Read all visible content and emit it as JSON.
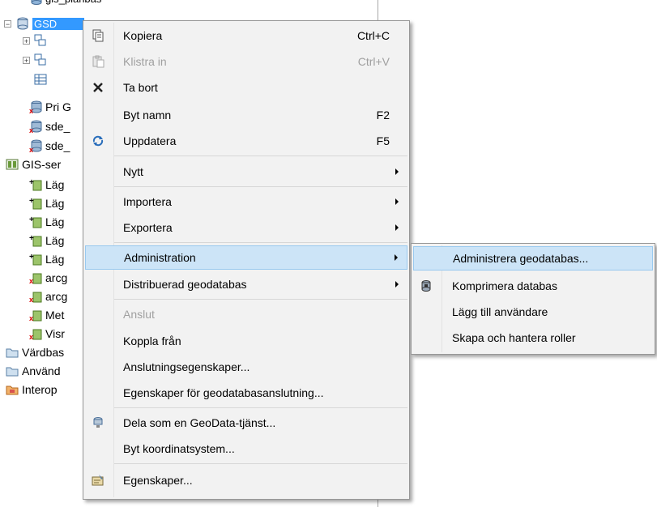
{
  "tree": {
    "partial_top": "gis_planbas",
    "selected": "GSD",
    "items": [
      {
        "label": "Pri G"
      },
      {
        "label": "sde_"
      },
      {
        "label": "sde_"
      },
      {
        "label": "GIS-ser"
      },
      {
        "label": "Läg"
      },
      {
        "label": "Läg"
      },
      {
        "label": "Läg"
      },
      {
        "label": "Läg"
      },
      {
        "label": "Läg"
      },
      {
        "label": "arcg"
      },
      {
        "label": "arcg"
      },
      {
        "label": "Met"
      },
      {
        "label": "Visr"
      },
      {
        "label": "Värdbas"
      },
      {
        "label": "Använd"
      },
      {
        "label": "Interop"
      }
    ]
  },
  "menu": {
    "items": [
      {
        "label": "Kopiera",
        "shortcut": "Ctrl+C",
        "icon": "copy-icon"
      },
      {
        "label": "Klistra in",
        "shortcut": "Ctrl+V",
        "icon": "paste-icon",
        "disabled": true
      },
      {
        "label": "Ta bort",
        "icon": "delete-icon"
      },
      {
        "label": "Byt namn",
        "shortcut": "F2"
      },
      {
        "label": "Uppdatera",
        "shortcut": "F5",
        "icon": "refresh-icon"
      },
      {
        "label": "Nytt",
        "submenu": true
      },
      {
        "label": "Importera",
        "submenu": true
      },
      {
        "label": "Exportera",
        "submenu": true
      },
      {
        "label": "Administration",
        "submenu": true,
        "highlighted": true
      },
      {
        "label": "Distribuerad geodatabas",
        "submenu": true
      },
      {
        "label": "Anslut",
        "disabled": true
      },
      {
        "label": "Koppla från"
      },
      {
        "label": "Anslutningsegenskaper..."
      },
      {
        "label": "Egenskaper för geodatabasanslutning..."
      },
      {
        "label": "Dela som en GeoData-tjänst...",
        "icon": "share-icon"
      },
      {
        "label": "Byt koordinatsystem..."
      },
      {
        "label": "Egenskaper...",
        "icon": "properties-icon"
      }
    ]
  },
  "submenu": {
    "items": [
      {
        "label": "Administrera geodatabas...",
        "highlighted": true
      },
      {
        "label": "Komprimera databas",
        "icon": "compress-icon"
      },
      {
        "label": "Lägg till användare"
      },
      {
        "label": "Skapa och hantera roller"
      }
    ]
  },
  "colors": {
    "menu_bg": "#f2f2f2",
    "highlight_bg": "#cce4f7",
    "highlight_border": "#99c9ef",
    "selection": "#3399ff"
  }
}
